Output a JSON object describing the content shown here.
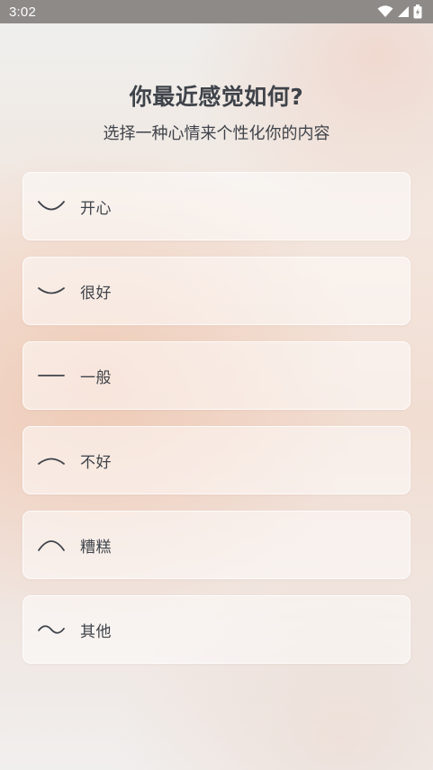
{
  "status_bar": {
    "time": "3:02",
    "icons": [
      "wifi-icon",
      "cellular-signal-icon",
      "battery-icon"
    ]
  },
  "header": {
    "title": "你最近感觉如何?",
    "subtitle": "选择一种心情来个性化你的内容"
  },
  "mood_options": [
    {
      "icon": "big-smile-curve-icon",
      "label": "开心"
    },
    {
      "icon": "smile-curve-icon",
      "label": "很好"
    },
    {
      "icon": "flat-line-icon",
      "label": "一般"
    },
    {
      "icon": "slight-frown-curve-icon",
      "label": "不好"
    },
    {
      "icon": "frown-curve-icon",
      "label": "糟糕"
    },
    {
      "icon": "tilde-wave-icon",
      "label": "其他"
    }
  ],
  "colors": {
    "text": "#3f434a",
    "status_bar": "#8d8a88"
  }
}
